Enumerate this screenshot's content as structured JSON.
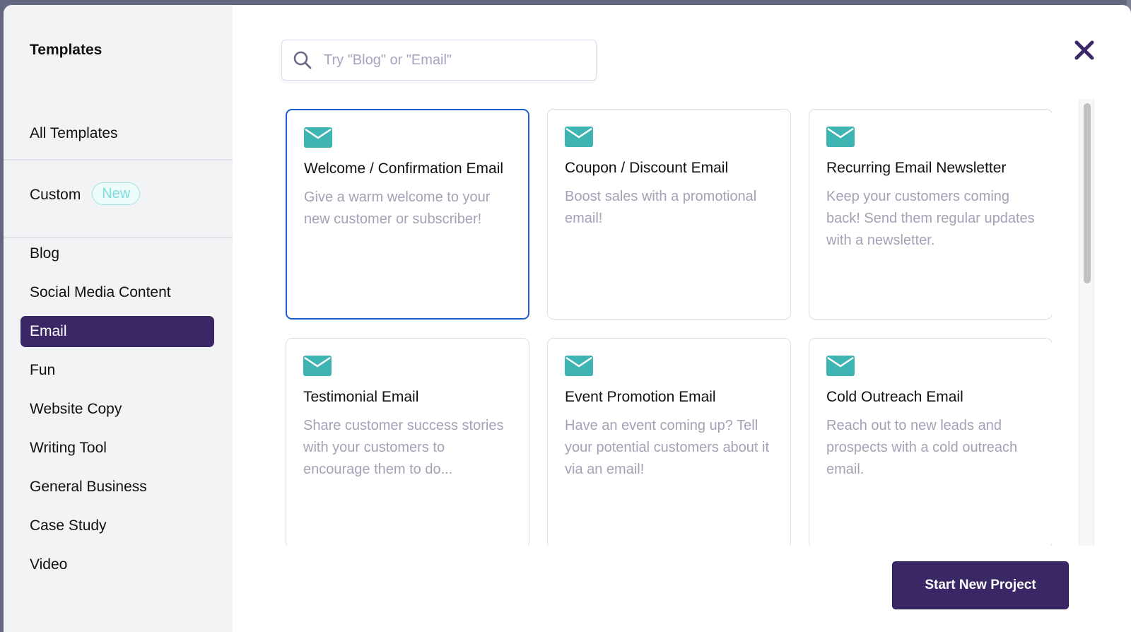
{
  "sidebar": {
    "title": "Templates",
    "all_templates": "All Templates",
    "custom": {
      "label": "Custom",
      "badge": "New"
    },
    "categories": [
      {
        "label": "Blog",
        "active": false
      },
      {
        "label": "Social Media Content",
        "active": false
      },
      {
        "label": "Email",
        "active": true
      },
      {
        "label": "Fun",
        "active": false
      },
      {
        "label": "Website Copy",
        "active": false
      },
      {
        "label": "Writing Tool",
        "active": false
      },
      {
        "label": "General Business",
        "active": false
      },
      {
        "label": "Case Study",
        "active": false
      },
      {
        "label": "Video",
        "active": false
      }
    ]
  },
  "search": {
    "placeholder": "Try \"Blog\" or \"Email\"",
    "value": ""
  },
  "close": {
    "icon": "close-icon"
  },
  "templates": [
    {
      "icon": "mail-icon",
      "title": "Welcome / Confirmation Email",
      "description": "Give a warm welcome to your new customer or subscriber!",
      "selected": true
    },
    {
      "icon": "mail-icon",
      "title": "Coupon / Discount Email",
      "description": "Boost sales with a promotional email!",
      "selected": false
    },
    {
      "icon": "mail-icon",
      "title": "Recurring Email Newsletter",
      "description": "Keep your customers coming back! Send them regular updates with a newsletter.",
      "selected": false
    },
    {
      "icon": "mail-icon",
      "title": "Testimonial Email",
      "description": "Share customer success stories with your customers to encourage them to do...",
      "selected": false
    },
    {
      "icon": "mail-icon",
      "title": "Event Promotion Email",
      "description": "Have an event coming up? Tell your potential customers about it via an email!",
      "selected": false
    },
    {
      "icon": "mail-icon",
      "title": "Cold Outreach Email",
      "description": "Reach out to new leads and prospects with a cold outreach email.",
      "selected": false
    }
  ],
  "footer": {
    "start_button": "Start New Project"
  },
  "colors": {
    "brand": "#3a2766",
    "accent_teal": "#3fb5b3",
    "selected_border": "#1d5fd1",
    "muted_text": "#a4a2b5"
  }
}
